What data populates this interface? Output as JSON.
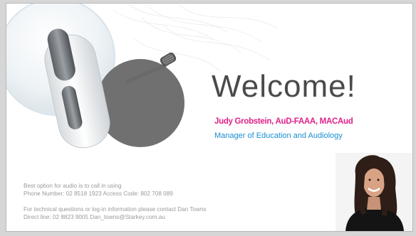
{
  "slide": {
    "title": "Welcome!",
    "presenter": {
      "name": "Judy Grobstein, AuD-FAAA, MACAud",
      "role": "Manager of Education and Audiology"
    },
    "audio_info": {
      "line1": "Best option for audio is to call in using",
      "line2": "Phone Number:  02 8518 1923  Access Code: 802 708 089"
    },
    "tech_info": {
      "line1": "For technical questions or log-in information please contact Dan Towns",
      "line2": "Direct line: 02 8823 9005   Dan_towns@Starkey.com.au"
    }
  },
  "colors": {
    "name_accent": "#e0218a",
    "role_accent": "#1a8fd0",
    "title_text": "#4a4a4a",
    "info_text": "#9a9a9a"
  },
  "icons": [
    "hearing-aid-image",
    "presenter-photo"
  ]
}
